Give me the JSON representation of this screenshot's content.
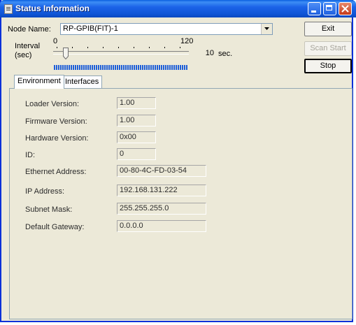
{
  "window": {
    "title": "Status Information"
  },
  "node": {
    "label": "Node Name:",
    "value": "RP-GPIB(FIT)-1"
  },
  "buttons": {
    "exit": "Exit",
    "scan_start": "Scan Start",
    "stop": "Stop"
  },
  "interval": {
    "label_line1": "Interval",
    "label_line2": "(sec)",
    "min_label": "0",
    "max_label": "120",
    "value": "10",
    "unit": "sec."
  },
  "progress": {
    "fill": 1.0
  },
  "tabs": [
    {
      "label": "Environment",
      "active": true
    },
    {
      "label": "Interfaces",
      "active": false
    }
  ],
  "environment": {
    "fields": [
      {
        "label": "Loader Version:",
        "value": "1.00"
      },
      {
        "label": "Firmware Version:",
        "value": "1.00"
      },
      {
        "label": "Hardware Version:",
        "value": "0x00"
      },
      {
        "label": "ID:",
        "value": "0"
      },
      {
        "label": "Ethernet Address:",
        "value": "00-80-4C-FD-03-54"
      },
      {
        "label": "IP Address:",
        "value": "192.168.131.222"
      },
      {
        "label": "Subnet Mask:",
        "value": "255.255.255.0"
      },
      {
        "label": "Default Gateway:",
        "value": "0.0.0.0"
      }
    ]
  },
  "colors": {
    "titlebar": "#0b54d8",
    "window_bg": "#ece9d8",
    "progress": "#1f5fd8"
  },
  "icons": {
    "window": "window-icon",
    "minimize": "minimize-icon",
    "maximize": "maximize-icon",
    "close": "close-icon",
    "dropdown": "chevron-down-icon",
    "slider": "slider-thumb-icon"
  }
}
